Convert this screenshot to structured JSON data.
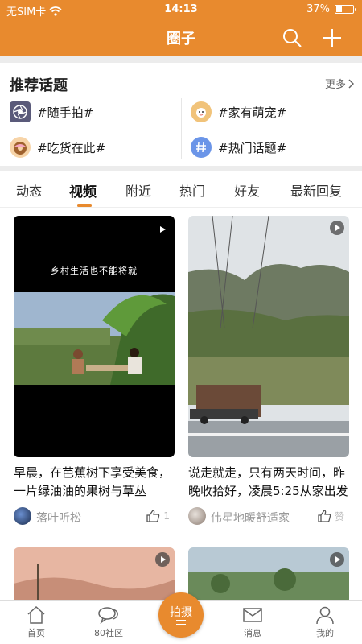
{
  "status": {
    "carrier": "无SIM卡",
    "time": "14:13",
    "battery": "37%",
    "battery_level": 0.37
  },
  "header": {
    "title": "圈子"
  },
  "topics": {
    "title": "推荐话题",
    "more": "更多",
    "items": [
      {
        "label": "#随手拍#",
        "icon": "camera-aperture-icon"
      },
      {
        "label": "#家有萌宠#",
        "icon": "pet-face-icon"
      },
      {
        "label": "#吃货在此#",
        "icon": "donut-icon"
      },
      {
        "label": "#热门话题#",
        "icon": "hashtag-icon"
      }
    ]
  },
  "tabs": [
    "动态",
    "视频",
    "附近",
    "热门",
    "好友",
    "最新回复"
  ],
  "active_tab": "视频",
  "feed": [
    {
      "caption": "早晨，在芭蕉树下享受美食，一片绿油油的果树与草丛",
      "overlay_text": "乡村生活也不能将就",
      "author": "落叶听松",
      "likes": "1"
    },
    {
      "caption": "说走就走，只有两天时间，昨晚收拾好，凌晨5:25从家出发",
      "overlay_text": "",
      "author": "伟星地暖舒适家",
      "likes": "赞"
    }
  ],
  "bottom_nav": {
    "home": "首页",
    "community": "80社区",
    "publish": "拍摄",
    "messages": "消息",
    "mine": "我的"
  },
  "colors": {
    "accent": "#e88a2e"
  }
}
